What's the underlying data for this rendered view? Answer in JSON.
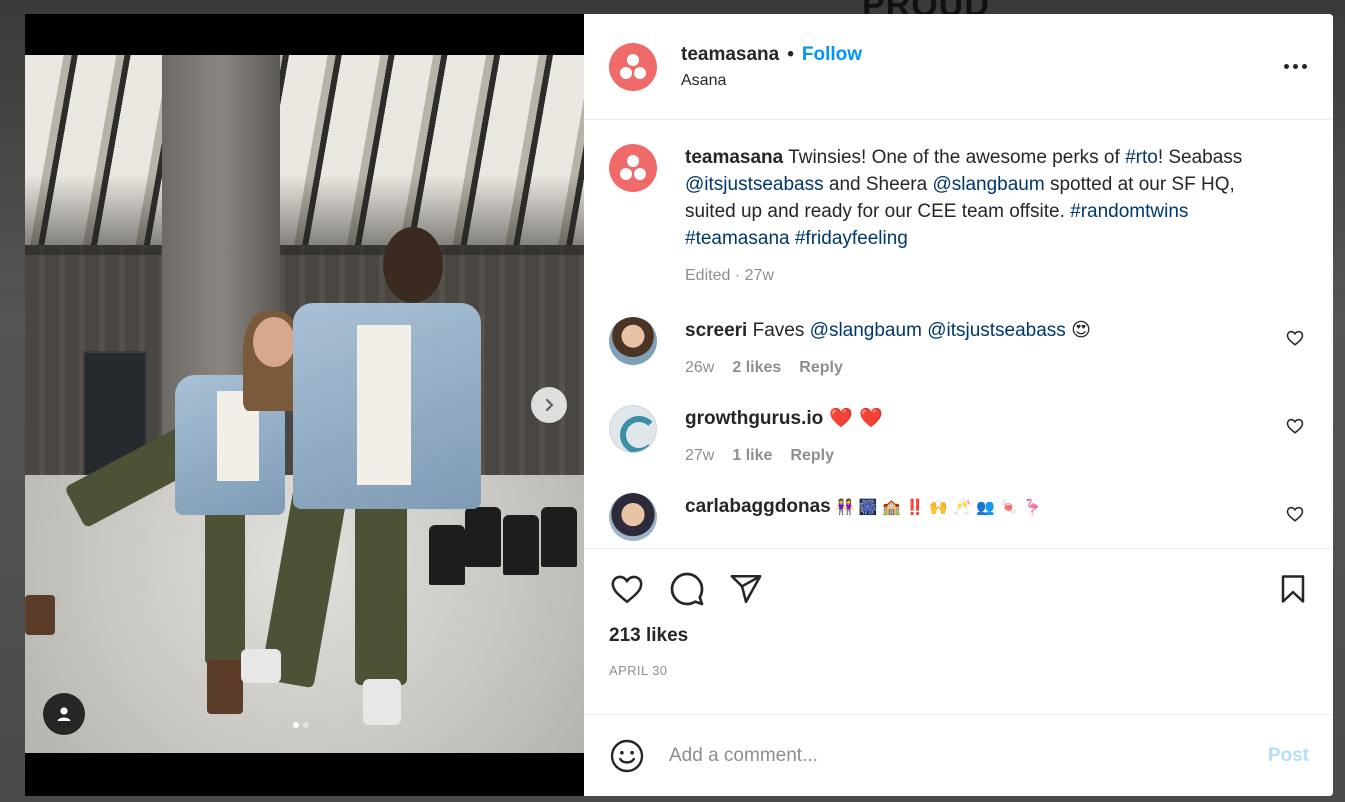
{
  "background_text": "PROUD",
  "post": {
    "author": "teamasana",
    "separator": "•",
    "follow_label": "Follow",
    "subtitle": "Asana",
    "caption": {
      "author": "teamasana",
      "t1": " Twinsies! One of the awesome perks of ",
      "tag_rto": "#rto",
      "t2": "! Seabass ",
      "mention_seabass": "@itsjustseabass",
      "t3": " and Sheera ",
      "mention_sheera": "@slangbaum",
      "t4": " spotted at our SF HQ, suited up and ready for our CEE team offsite. ",
      "tag_randomtwins": "#randomtwins",
      "tag_teamasana": "#teamasana",
      "tag_fridayfeeling": "#fridayfeeling",
      "meta": "Edited · 27w"
    },
    "comments": [
      {
        "user": "screeri",
        "text": " Faves ",
        "mention1": "@slangbaum",
        "mention2": "@itsjustseabass",
        "emoji": "😍",
        "time": "26w",
        "likes": "2 likes",
        "reply": "Reply"
      },
      {
        "user": "growthgurus.io",
        "emoji": " ❤️ ❤️",
        "time": "27w",
        "likes": "1 like",
        "reply": "Reply"
      },
      {
        "user": "carlabaggdonas",
        "emoji": " 👭 🎆 🏫 ‼️ 🙌 🥂 👥 🍬 🦩"
      }
    ],
    "likes": "213 likes",
    "date": "APRIL 30",
    "comment_placeholder": "Add a comment...",
    "post_label": "Post"
  },
  "media": {
    "slide_count": 2,
    "active_slide": 1
  },
  "colors": {
    "accent": "#0095f6",
    "asana": "#f06a6a",
    "link": "#00376b"
  }
}
